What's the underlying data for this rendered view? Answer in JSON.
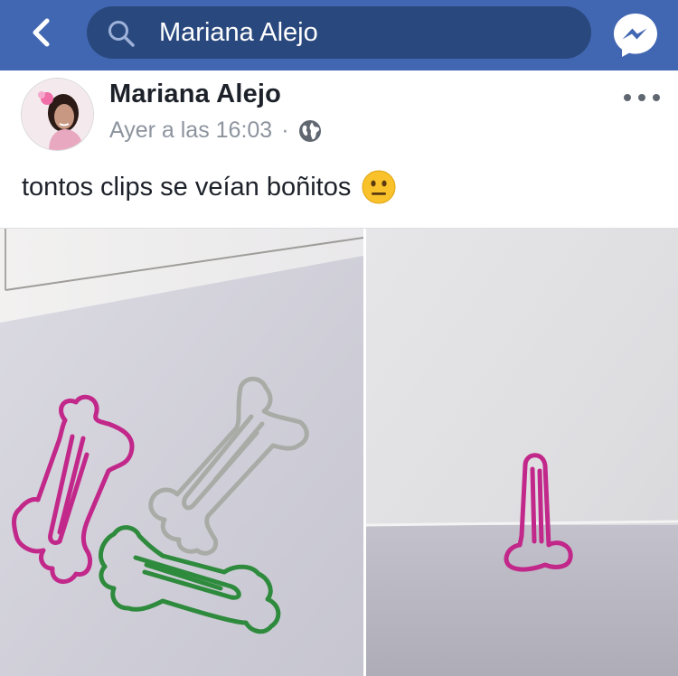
{
  "header": {
    "back_icon": "chevron-left-icon",
    "search_icon": "search-icon",
    "search_value": "Mariana Alejo",
    "messenger_icon": "messenger-icon",
    "bar_color": "#4267b2",
    "search_bg_color": "#29487d"
  },
  "post": {
    "author": "Mariana Alejo",
    "timestamp": "Ayer a las 16:03",
    "separator": "·",
    "privacy_icon": "globe-icon",
    "more_icon": "more-options-icon",
    "text": "tontos clips se veían boñitos",
    "emoji": "neutral-face-emoji",
    "photos": [
      {
        "description_icon": "photo",
        "subject": "bone-shaped paper clips pink gray green"
      },
      {
        "description_icon": "photo",
        "subject": "pink bone-shaped paper clip on paper"
      }
    ],
    "colors": {
      "clip_pink": "#c2278a",
      "clip_gray": "#a9aca6",
      "clip_green": "#2e8a3c"
    }
  }
}
